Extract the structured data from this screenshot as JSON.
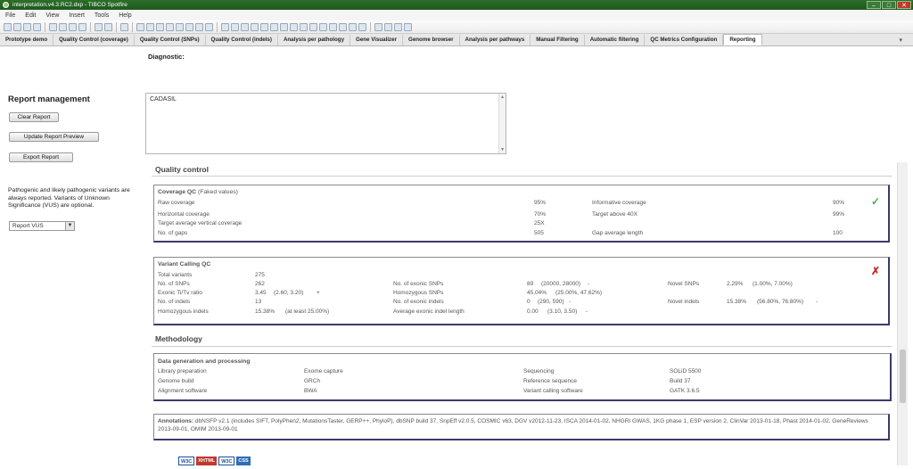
{
  "window": {
    "title": "interpretation.v4.3.RC2.dxp - TIBCO Spotfire",
    "minimize": "–",
    "maximize": "□",
    "close": "✕"
  },
  "menu": [
    "File",
    "Edit",
    "View",
    "Insert",
    "Tools",
    "Help"
  ],
  "tabs": [
    "Prototype demo",
    "Quality Control (coverage)",
    "Quality Control (SNPs)",
    "Quality Control (indels)",
    "Analysis per pathology",
    "Gene Visualizer",
    "Genome browser",
    "Analysis per pathways",
    "Manual Filtering",
    "Automatic filtering",
    "QC Metrics Configuration",
    "Reporting"
  ],
  "active_tab": "Reporting",
  "tab_scroll": "▾",
  "diagnostic": {
    "label": "Diagnostic:",
    "value": "CADASIL"
  },
  "left": {
    "title": "Report management",
    "clear": "Clear Report",
    "update": "Update Report Preview",
    "export": "Export Report",
    "note": "Pathogenic and likely pathogenic variants are always reported. Variants of Unknown Significance (VUS) are optional.",
    "select_value": "Report VUS"
  },
  "report": {
    "quality_title": "Quality control",
    "coverage": {
      "title": "Coverage QC",
      "subtitle": "(Faked values)",
      "rows": [
        [
          "Raw coverage",
          "95%",
          "Informative coverage",
          "90%"
        ],
        [
          "Horizontal coverage",
          "70%",
          "Target above 40X",
          "99%"
        ],
        [
          "Target average vertical coverage",
          "25X",
          "",
          ""
        ],
        [
          "No. of gaps",
          "505",
          "Gap average length",
          "100"
        ]
      ]
    },
    "variant": {
      "title": "Variant Calling QC",
      "total_label": "Total variants",
      "total_value": "275",
      "snps_label": "No. of SNPs",
      "snps_value": "262",
      "titv_label": "Exonic Ti/Tv ratio",
      "titv_value": "3.45",
      "titv_range": "(2.60, 3.20)",
      "titv_flag": "+",
      "indels_label": "No. of indels",
      "indels_value": "13",
      "homindels_label": "Homozygous indels",
      "homindels_value": "15.38%",
      "homindels_range": "(at least 25.00%)",
      "exsnps_label": "No. of exonic SNPs",
      "exsnps_value": "89",
      "exsnps_range": "(20000, 28000)",
      "exsnps_flag": "-",
      "homsnps_label": "Homozygous SNPs",
      "homsnps_value": "45.04%",
      "homsnps_range": "(25.00%, 47.62%)",
      "exindels_label": "No. of exonic indels",
      "exindels_value": "0",
      "exindels_range": "(290, 590)",
      "exindels_flag": "-",
      "avgindel_label": "Average exonic indel length",
      "avgindel_value": "0.00",
      "avgindel_range": "(3.10, 3.50)",
      "avgindel_flag": "-",
      "novsnps_label": "Novel SNPs",
      "novsnps_value": "2.29%",
      "novsnps_range": "(1.00%, 7.00%)",
      "novindels_label": "Novel indels",
      "novindels_value": "15.38%",
      "novindels_range": "(56.80%, 76.80%)",
      "novindels_flag": "-"
    },
    "methodology_title": "Methodology",
    "data_gen": {
      "title": "Data generation and processing",
      "rows": [
        [
          "Library preparation",
          "Exome capture",
          "Sequencing",
          "SOLiD 5500"
        ],
        [
          "Genome build",
          "GRCh",
          "Reference sequence",
          "Build 37"
        ],
        [
          "Alignment software",
          "BWA",
          "Variant calling software",
          "GATK 3.6.5"
        ]
      ]
    },
    "annotations_label": "Annotations:",
    "annotations_text": "dbNSFP v2.1 (includes SIFT, PolyPhen2, MutationsTaster, GERP++, PhyloP), dbSNP build 37, SnpEff v2.0.5, COSMIC v63, DGV v2012-11-23, ISCA 2014-01-02, NHGRI GWAS, 1KG phase 1, ESP version 2, ClinVar 2013-01-18, Phast 2014-01-02, GeneReviews 2013-09-01, OMIM 2013-09-01",
    "logos": [
      "W3C",
      "XHTML",
      "W3C",
      "CSS"
    ]
  },
  "colors": {
    "titlebar": "#1d5a1d",
    "panel_border": "#3a3a6a",
    "check": "#4caf50",
    "cross": "#c62828"
  }
}
